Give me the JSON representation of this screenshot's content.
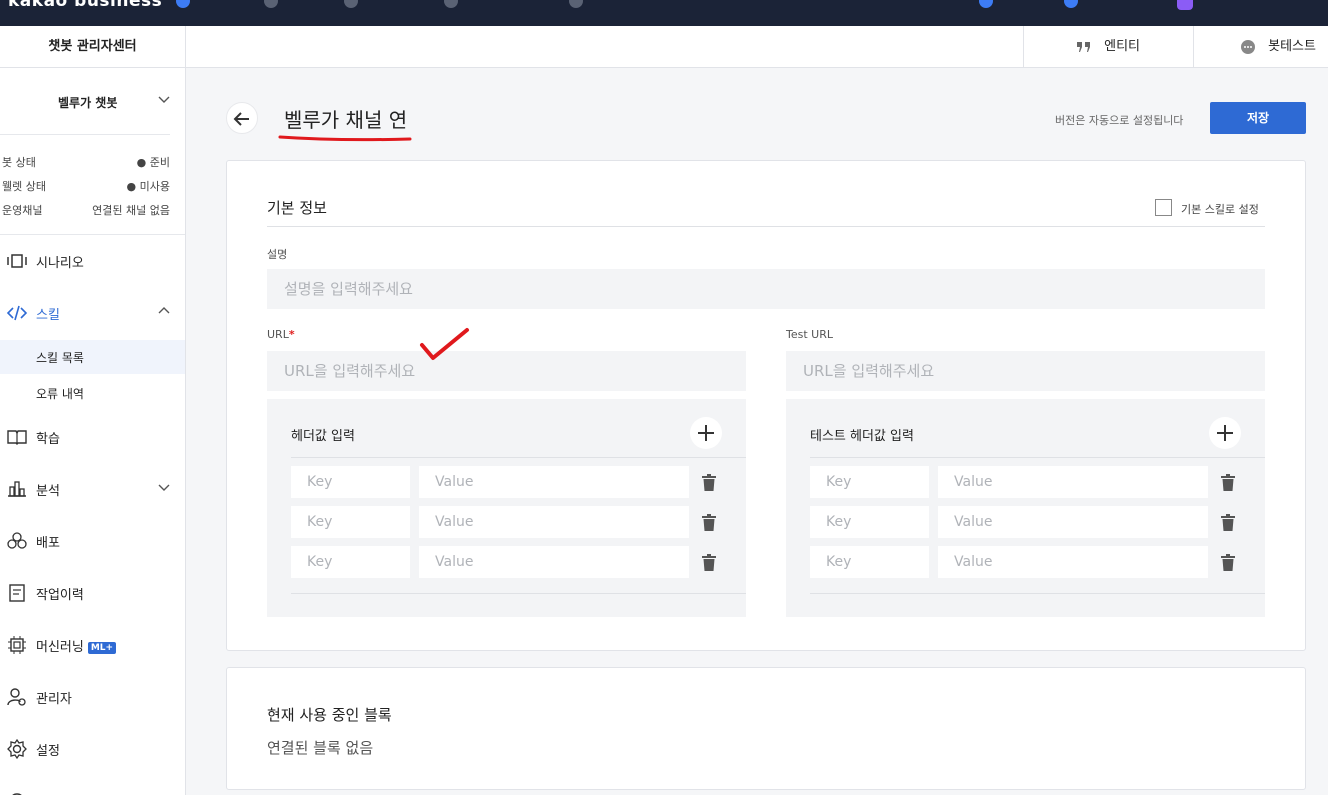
{
  "topbar": {
    "brand": "kakao business",
    "nav": [
      "",
      "",
      "",
      "",
      ""
    ],
    "right": [
      "",
      "",
      ""
    ]
  },
  "sidebar": {
    "title": "챗봇 관리자센터",
    "bot_name": "벨루가 챗봇",
    "status": [
      {
        "key": "봇 상태",
        "value": "● 준비"
      },
      {
        "key": "웰렛 상태",
        "value": "● 미사용"
      },
      {
        "key": "운영채널",
        "value": "연결된 채널 없음"
      }
    ],
    "menu": {
      "scenario": "시나리오",
      "skill": "스킬",
      "skill_list": "스킬 목록",
      "error_log": "오류 내역",
      "learning": "학습",
      "analysis": "분석",
      "deploy": "배포",
      "history": "작업이력",
      "ml": "머신러닝",
      "ml_badge": "ML+",
      "admin": "관리자",
      "settings": "설정"
    }
  },
  "subheader": {
    "entity": "엔티티",
    "bottest": "봇테스트"
  },
  "page": {
    "title": "벨루가 채널 연",
    "version_note": "버전은 자동으로 설정됩니다",
    "save": "저장"
  },
  "basic_info": {
    "title": "기본 정보",
    "default_skill_label": "기본 스킬로 설정",
    "description_label": "설명",
    "description_placeholder": "설명을 입력해주세요",
    "url_label": "URL",
    "url_required": "*",
    "url_placeholder": "URL을 입력해주세요",
    "test_url_label": "Test URL",
    "test_url_placeholder": "URL을 입력해주세요",
    "header_title": "헤더값 입력",
    "test_header_title": "테스트 헤더값 입력",
    "key_placeholder": "Key",
    "value_placeholder": "Value"
  },
  "blocks": {
    "title": "현재 사용 중인 블록",
    "empty": "연결된 블록 없음"
  },
  "colors": {
    "accent": "#2e6ad4",
    "topbar": "#1b2337",
    "required": "#e02020",
    "annotation": "#e0191d"
  }
}
